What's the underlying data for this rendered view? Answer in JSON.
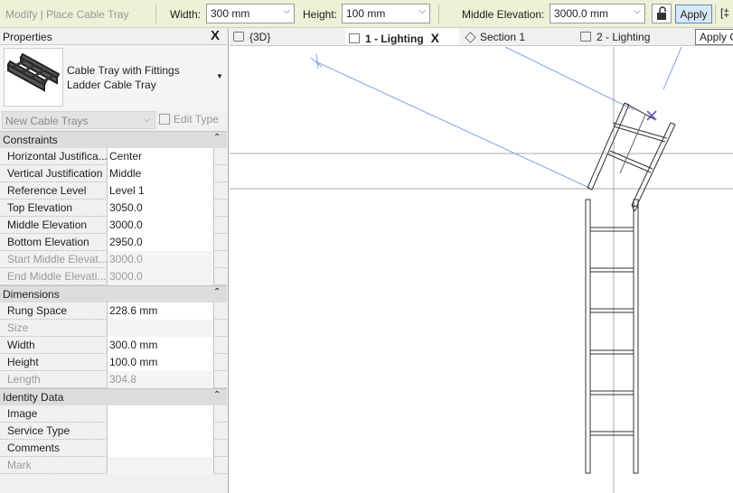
{
  "options_bar": {
    "mode_label": "Modify | Place Cable Tray",
    "width_label": "Width:",
    "width_value": "300 mm",
    "height_label": "Height:",
    "height_value": "100 mm",
    "middle_elevation_label": "Middle Elevation:",
    "middle_elevation_value": "3000.0 mm",
    "apply_label": "Apply",
    "truncated_glyph": "[‡"
  },
  "properties": {
    "title": "Properties",
    "close": "X",
    "type_family": "Cable Tray with Fittings",
    "type_name": "Ladder Cable Tray",
    "type_dropdown_glyph": "▼",
    "instance_selector": "New Cable Trays",
    "edit_type": "Edit Type",
    "sections": [
      {
        "title": "Constraints",
        "rows": [
          {
            "label": "Horizontal Justifica...",
            "value": "Center",
            "dim": false
          },
          {
            "label": "Vertical Justification",
            "value": "Middle",
            "dim": false
          },
          {
            "label": "Reference Level",
            "value": "Level 1",
            "dim": false
          },
          {
            "label": "Top Elevation",
            "value": "3050.0",
            "dim": false
          },
          {
            "label": "Middle Elevation",
            "value": "3000.0",
            "dim": false
          },
          {
            "label": "Bottom Elevation",
            "value": "2950.0",
            "dim": false
          },
          {
            "label": "Start Middle Elevat...",
            "value": "3000.0",
            "dim": true
          },
          {
            "label": "End Middle Elevati...",
            "value": "3000.0",
            "dim": true
          }
        ]
      },
      {
        "title": "Dimensions",
        "rows": [
          {
            "label": "Rung Space",
            "value": "228.6 mm",
            "dim": false
          },
          {
            "label": "Size",
            "value": "",
            "dim": true
          },
          {
            "label": "Width",
            "value": "300.0 mm",
            "dim": false
          },
          {
            "label": "Height",
            "value": "100.0 mm",
            "dim": false
          },
          {
            "label": "Length",
            "value": "304.8",
            "dim": true
          }
        ]
      },
      {
        "title": "Identity Data",
        "rows": [
          {
            "label": "Image",
            "value": "",
            "dim": false
          },
          {
            "label": "Service Type",
            "value": "",
            "dim": false
          },
          {
            "label": "Comments",
            "value": "",
            "dim": false
          },
          {
            "label": "Mark",
            "value": "",
            "dim": true
          }
        ]
      }
    ]
  },
  "tabs": [
    {
      "label": "{3D}",
      "icon": "3d-view-icon",
      "active": false
    },
    {
      "label": "1 - Lighting",
      "icon": "floor-plan-icon",
      "active": true
    },
    {
      "label": "Section 1",
      "icon": "section-view-icon",
      "active": false
    },
    {
      "label": "2 - Lighting",
      "icon": "floor-plan-icon",
      "active": false
    }
  ],
  "tab_close": "X",
  "tooltip": "Apply C",
  "colors": {
    "options_bar_bg": "#eef0d7",
    "apply_button_bg": "#d9e8f9",
    "blue_line": "#7fa3e0",
    "cursor_mark": "#6e6ec8"
  }
}
